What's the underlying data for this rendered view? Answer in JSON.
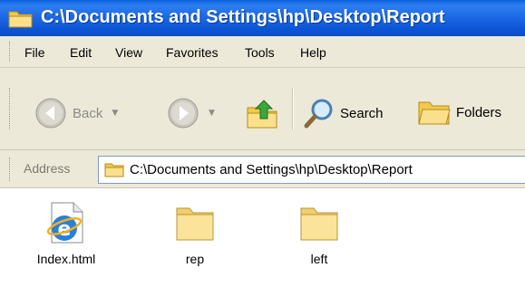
{
  "window": {
    "title": "C:\\Documents and Settings\\hp\\Desktop\\Report",
    "title_icon": "folder-icon"
  },
  "menu": {
    "items": [
      "File",
      "Edit",
      "View",
      "Favorites",
      "Tools",
      "Help"
    ]
  },
  "toolbar": {
    "back_label": "Back",
    "search_label": "Search",
    "folders_label": "Folders"
  },
  "address": {
    "label": "Address",
    "value": "C:\\Documents and Settings\\hp\\Desktop\\Report"
  },
  "files": [
    {
      "name": "Index.html",
      "icon": "ie-html-icon"
    },
    {
      "name": "rep",
      "icon": "folder-icon"
    },
    {
      "name": "left",
      "icon": "folder-icon"
    }
  ],
  "colors": {
    "titlebar": "#0a5fe0",
    "chrome": "#ece9d8",
    "folder": "#f7d97a"
  }
}
